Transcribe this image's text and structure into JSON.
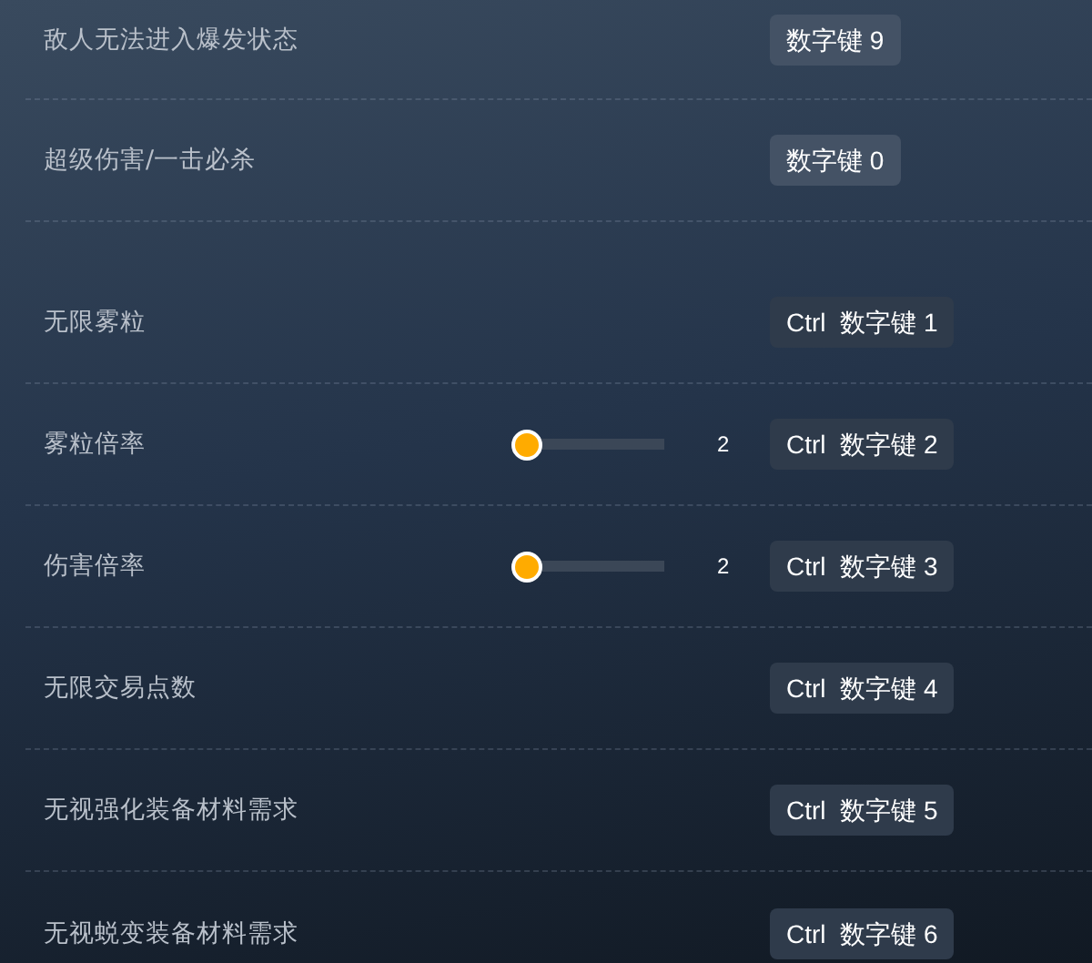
{
  "sections": [
    {
      "rows": [
        {
          "kind": "toggle",
          "label": "敌人无法进入爆发状态",
          "hotkey": "数字键 9"
        },
        {
          "kind": "toggle",
          "label": "超级伤害/一击必杀",
          "hotkey": "数字键 0"
        }
      ]
    },
    {
      "rows": [
        {
          "kind": "toggle",
          "label": "无限雾粒",
          "hotkey": "Ctrl  数字键 1"
        },
        {
          "kind": "slider",
          "label": "雾粒倍率",
          "level": 0,
          "value": "2",
          "hotkey": "Ctrl  数字键 2"
        },
        {
          "kind": "slider",
          "label": "伤害倍率",
          "level": 0,
          "value": "2",
          "hotkey": "Ctrl  数字键 3"
        },
        {
          "kind": "toggle",
          "label": "无限交易点数",
          "hotkey": "Ctrl  数字键 4"
        },
        {
          "kind": "toggle",
          "label": "无视强化装备材料需求",
          "hotkey": "Ctrl  数字键 5"
        },
        {
          "kind": "toggle",
          "label": "无视蜕变装备材料需求",
          "hotkey": "Ctrl  数字键 6"
        }
      ]
    }
  ]
}
